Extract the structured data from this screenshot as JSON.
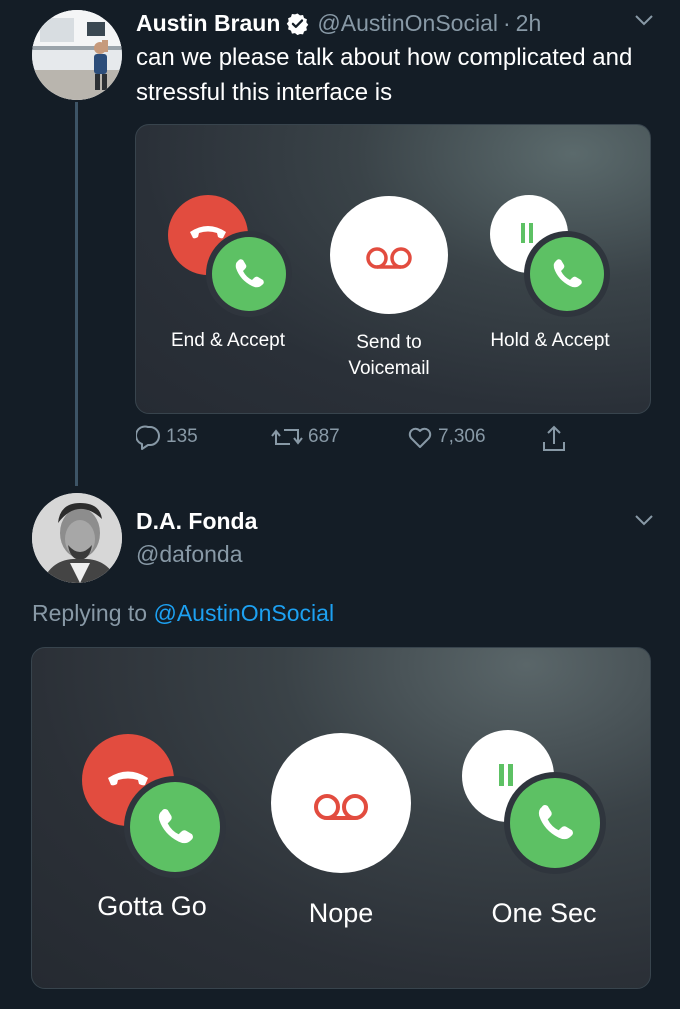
{
  "colors": {
    "background": "#141d26",
    "text_primary": "#ffffff",
    "text_secondary": "#8899a6",
    "link": "#1da1f2",
    "decline_red": "#e24c3f",
    "accept_green": "#5dc164"
  },
  "tweet": {
    "author": {
      "name": "Austin Braun",
      "verified": true,
      "handle": "@AustinOnSocial",
      "separator": "·",
      "time": "2h",
      "avatar_icon": "user-photo-avatar"
    },
    "text": "can we please talk about how complicated and stressful this interface is",
    "image": {
      "buttons": [
        {
          "label": "End & Accept",
          "icon": "end-and-accept-icon"
        },
        {
          "label": "Send to Voicemail",
          "label_line1": "Send to",
          "label_line2": "Voicemail",
          "icon": "voicemail-icon"
        },
        {
          "label": "Hold & Accept",
          "icon": "hold-and-accept-icon"
        }
      ]
    },
    "actions": {
      "replies": "135",
      "retweets": "687",
      "likes": "7,306",
      "share_icon": "share-icon"
    }
  },
  "reply": {
    "author": {
      "name": "D.A. Fonda",
      "handle": "@dafonda",
      "avatar_icon": "user-photo-avatar"
    },
    "replying_prefix": "Replying to",
    "replying_to": "@AustinOnSocial",
    "image": {
      "buttons": [
        {
          "label": "Gotta Go",
          "icon": "end-and-accept-icon"
        },
        {
          "label": "Nope",
          "icon": "voicemail-icon"
        },
        {
          "label": "One Sec",
          "icon": "hold-and-accept-icon"
        }
      ]
    }
  }
}
